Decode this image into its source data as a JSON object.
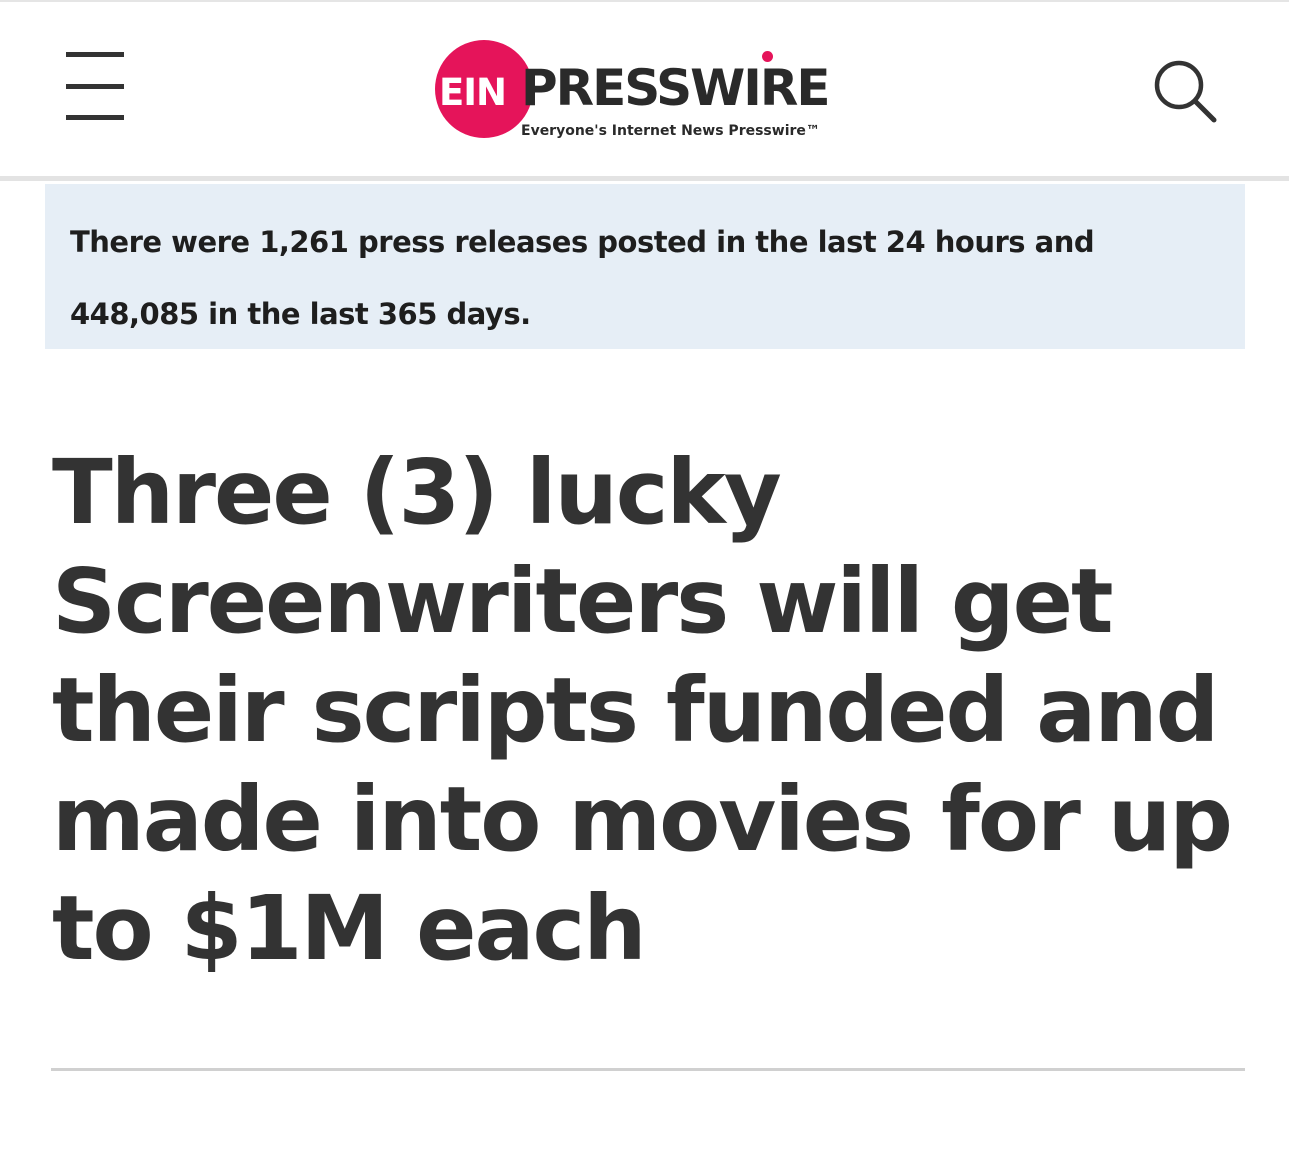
{
  "header": {
    "menu_icon": "hamburger-menu-icon",
    "logo": {
      "ein": "EIN",
      "presswire": "PRESSWIRE",
      "tagline": "Everyone's Internet News Presswire™"
    },
    "search_icon": "search-icon"
  },
  "stats": {
    "text": "There were 1,261 press releases posted in the last 24 hours and 448,085 in the last 365 days."
  },
  "article": {
    "headline": "Three (3) lucky Screenwriters will get their scripts funded and made into movies for up to $1M each"
  },
  "colors": {
    "brand": "#e5145a",
    "text": "#333333",
    "stats_background": "#e6eef6"
  }
}
